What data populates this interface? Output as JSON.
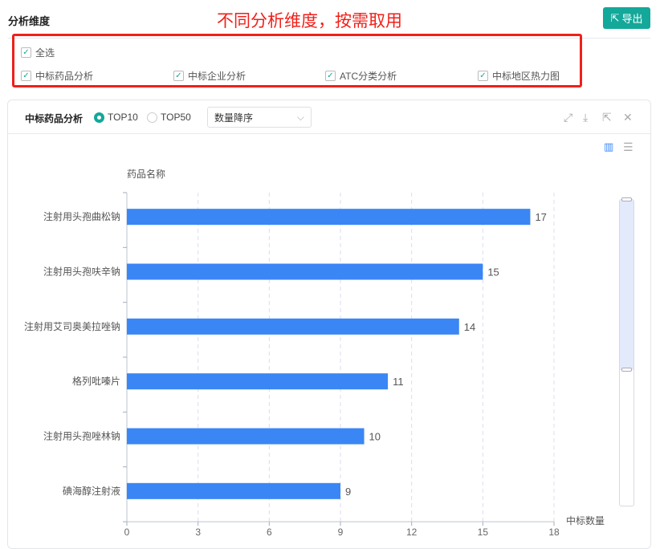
{
  "header": {
    "title": "分析维度",
    "annotation": "不同分析维度，按需取用",
    "export_label": "导出"
  },
  "options": {
    "select_all": "全选",
    "items": [
      "中标药品分析",
      "中标企业分析",
      "ATC分类分析",
      "中标地区热力图"
    ]
  },
  "panel": {
    "title": "中标药品分析",
    "radios": [
      "TOP10",
      "TOP50"
    ],
    "radio_selected": "TOP10",
    "sort_select": "数量降序"
  },
  "colors": {
    "accent": "#13a89a",
    "bar": "#3a86f5",
    "annotation": "#f0201a"
  },
  "chart_data": {
    "type": "bar",
    "orientation": "horizontal",
    "ylabel": "药品名称",
    "xlabel": "中标数量",
    "categories": [
      "注射用头孢曲松钠",
      "注射用头孢呋辛钠",
      "注射用艾司奥美拉唑钠",
      "格列吡嗪片",
      "注射用头孢唑林钠",
      "碘海醇注射液"
    ],
    "values": [
      17,
      15,
      14,
      11,
      10,
      9
    ],
    "xlim": [
      0,
      18
    ],
    "xticks": [
      0,
      3,
      6,
      9,
      12,
      15,
      18
    ],
    "grid": "vertical-dashed"
  }
}
